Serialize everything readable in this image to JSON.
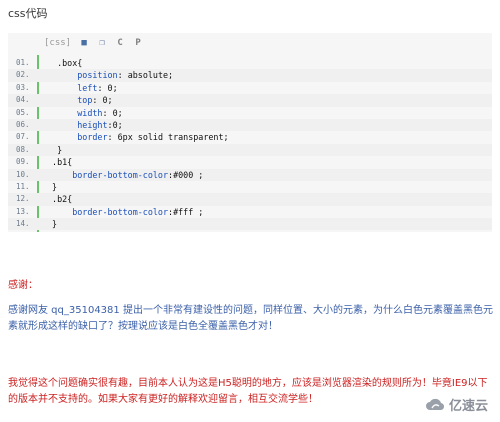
{
  "heading": "css代码",
  "code": {
    "lang_label": "[css]",
    "toolbar_icons": [
      "view-source-icon",
      "copy-icon",
      "print-icon",
      "help-icon"
    ],
    "lines": [
      {
        "num": "01.",
        "indent": "  ",
        "prop": "",
        "rest": ".box{"
      },
      {
        "num": "02.",
        "indent": "      ",
        "prop": "position",
        "rest": ": absolute;"
      },
      {
        "num": "03.",
        "indent": "      ",
        "prop": "left",
        "rest": ": 0;"
      },
      {
        "num": "04.",
        "indent": "      ",
        "prop": "top",
        "rest": ": 0;"
      },
      {
        "num": "05.",
        "indent": "      ",
        "prop": "width",
        "rest": ": 0;"
      },
      {
        "num": "06.",
        "indent": "      ",
        "prop": "height",
        "rest": ":0;"
      },
      {
        "num": "07.",
        "indent": "      ",
        "prop": "border",
        "rest": ": 6px solid transparent;"
      },
      {
        "num": "08.",
        "indent": "  ",
        "prop": "",
        "rest": "}"
      },
      {
        "num": "09.",
        "indent": " ",
        "prop": "",
        "rest": ".b1{"
      },
      {
        "num": "10.",
        "indent": "     ",
        "prop": "border-bottom-color",
        "rest": ":#000 ;"
      },
      {
        "num": "11.",
        "indent": " ",
        "prop": "",
        "rest": "}"
      },
      {
        "num": "12.",
        "indent": " ",
        "prop": "",
        "rest": ".b2{"
      },
      {
        "num": "13.",
        "indent": "     ",
        "prop": "border-bottom-color",
        "rest": ":#fff ;"
      },
      {
        "num": "14.",
        "indent": " ",
        "prop": "",
        "rest": "}"
      }
    ]
  },
  "note": {
    "title": "感谢：",
    "body": "感谢网友 qq_35104381 提出一个非常有建设性的问题，同样位置、大小的元素，为什么白色元素覆盖黑色元素就形成这样的缺口了？按理说应该是白色全覆盖黑色才对！",
    "extra": "我觉得这个问题确实很有趣，目前本人认为这是H5聪明的地方，应该是浏览器渲染的规则所为！毕竟IE9以下的版本并不支持的。如果大家有更好的解释欢迎留言，相互交流学些！"
  },
  "brand": {
    "name": "亿速云",
    "logo_icon": "cloud-logo-icon"
  },
  "colors": {
    "prop": "#1a4fb8",
    "gutter": "#6ac36a",
    "note_title": "#cc2222",
    "note_body": "#3a5fa8"
  }
}
